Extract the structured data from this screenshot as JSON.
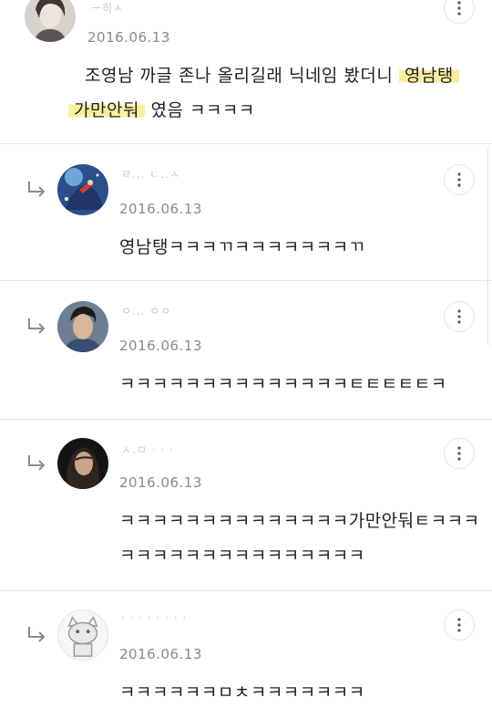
{
  "comments": [
    {
      "username": "ㅡ히ㅅ",
      "date": "2016.06.13",
      "text_line1": "조영남 까글 존나 올리길래 닉네임 봤더니 ",
      "highlight1": "영남탱",
      "highlight2": "가만안둬",
      "text_line2_rest": " 였음 ㅋㅋㅋㅋ",
      "avatar_icon": "user-avatar-woman-icon",
      "more_icon": "more-vertical-icon"
    },
    {
      "username": "ㄹ...   ㄴ..ㅅ",
      "date": "2016.06.13",
      "text": "영남탱ㅋㅋㅋㄲㅋㅋㅋㅋㅋㅋㅋㄲ",
      "avatar_icon": "user-avatar-illustration-icon",
      "reply_icon": "reply-arrow-icon",
      "more_icon": "more-vertical-icon"
    },
    {
      "username": "ㅇ...  ㅇㅇ",
      "date": "2016.06.13",
      "text": "ㅋㅋㅋㅋㅋㅋㅋㅋㅋㅋㅋㅋㅋㅋㅌㅌㅌㅌㅌㅋ",
      "avatar_icon": "user-avatar-man-icon",
      "reply_icon": "reply-arrow-icon",
      "more_icon": "more-vertical-icon"
    },
    {
      "username": "ㅅ.ㅁ  ·  ·     ·",
      "date": "2016.06.13",
      "text_line1": "ㅋㅋㅋㅋㅋㅋㅋㅋㅋㅋㅋㅋㅋㅋ가만안둬ㅌㅋㅋㅋ",
      "text_line2": "ㅋㅋㅋㅋㅋㅋㅋㅋㅋㅋㅋㅋㅋㅋㅋ",
      "avatar_icon": "user-avatar-woman-dark-icon",
      "reply_icon": "reply-arrow-icon",
      "more_icon": "more-vertical-icon"
    },
    {
      "username": "·  ·  ·  ·  ·  ·  ·  ·",
      "date": "2016.06.13",
      "text": "ㅋㅋㅋㅋㅋㅋㅁㅊㅋㅋㅋㅋㅋㅋㅋ",
      "avatar_icon": "user-avatar-cartoon-icon",
      "reply_icon": "reply-arrow-icon",
      "more_icon": "more-vertical-icon"
    }
  ]
}
